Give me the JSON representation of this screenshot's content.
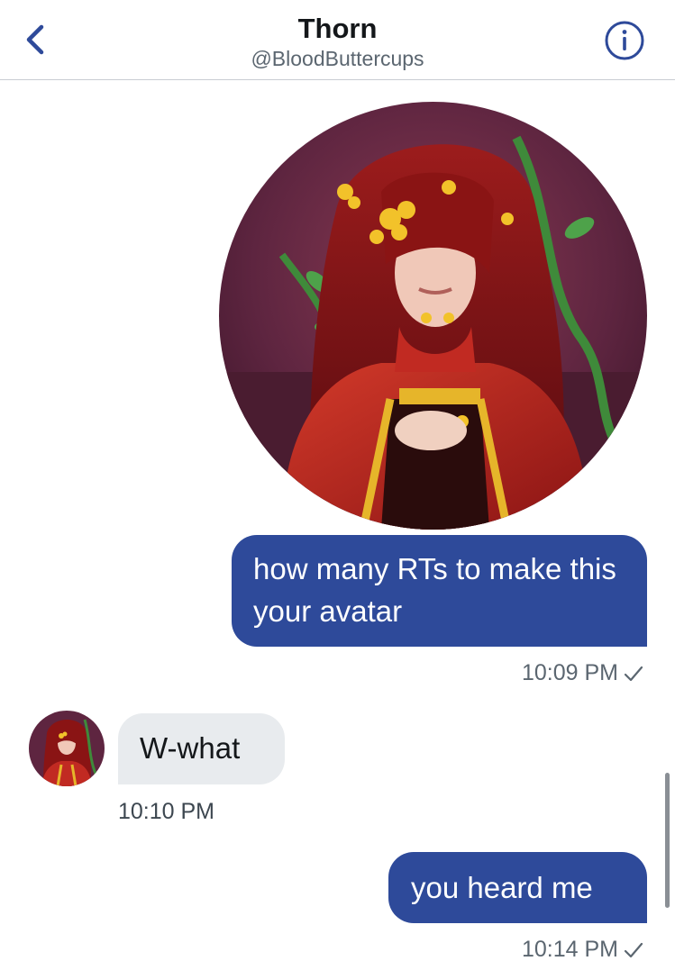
{
  "header": {
    "title": "Thorn",
    "handle": "@BloodButtercups",
    "back_icon": "chevron-left-icon",
    "info_icon": "info-circle-icon",
    "accent": "#2e4a9a"
  },
  "media": {
    "icon": "avatar-artwork-image"
  },
  "messages": [
    {
      "direction": "outgoing",
      "text": "how many RTs to make this your avatar",
      "time": "10:09 PM"
    },
    {
      "direction": "incoming",
      "text": "W-what",
      "time": "10:10 PM"
    },
    {
      "direction": "outgoing",
      "text": "you heard me",
      "time": "10:14 PM"
    }
  ],
  "colors": {
    "outgoing_bubble": "#2e4a9a",
    "incoming_bubble": "#e8ebee",
    "timestamp": "#5b6670"
  }
}
